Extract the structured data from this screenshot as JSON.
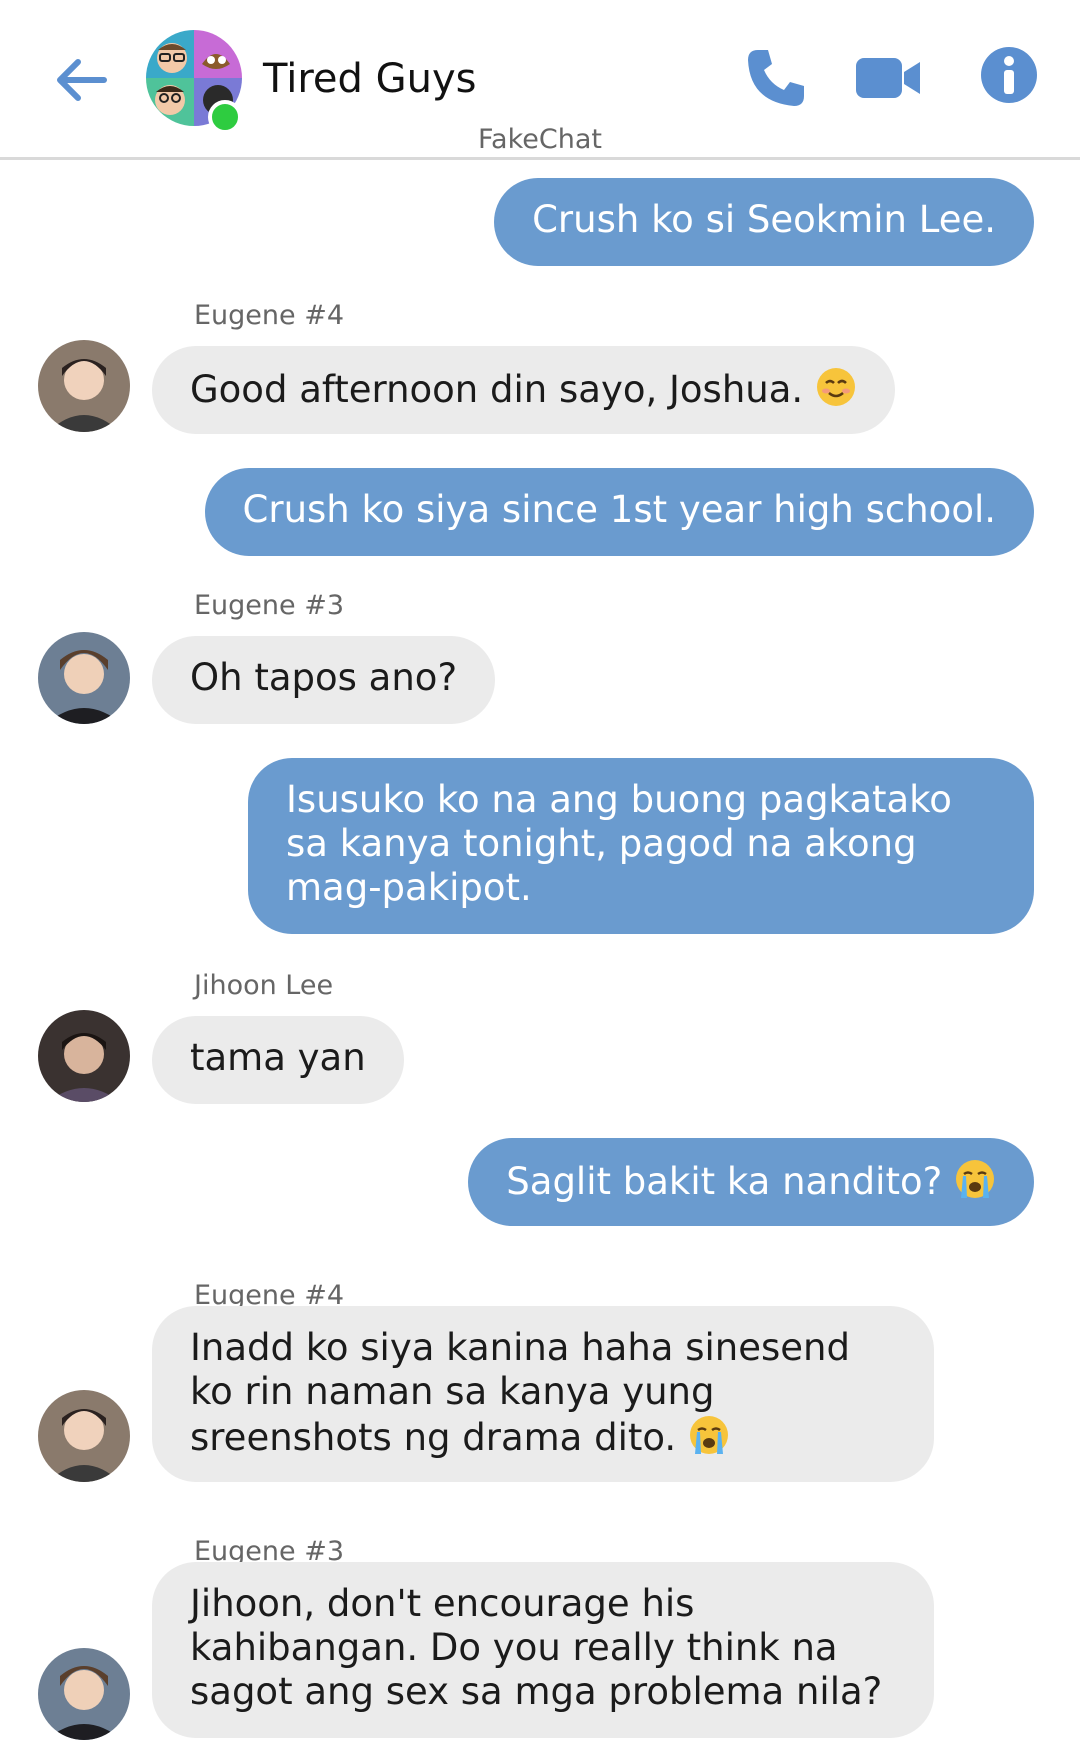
{
  "header": {
    "title": "Tired Guys",
    "watermark": "FakeChat",
    "back_icon": "arrow-left-icon",
    "call_icon": "phone-icon",
    "video_icon": "video-camera-icon",
    "info_icon": "info-icon",
    "accent_color": "#5b8fd0",
    "online_color": "#2ecc40"
  },
  "colors": {
    "outgoing_bubble": "#6a9bcf",
    "incoming_bubble": "#ebebeb"
  },
  "messages": [
    {
      "direction": "out",
      "text": "Crush ko si Seokmin Lee."
    },
    {
      "direction": "in",
      "sender": "Eugene #4",
      "text": "Good afternoon din sayo, Joshua.",
      "emoji": "smiling-blush-emoji"
    },
    {
      "direction": "out",
      "text": "Crush ko siya since 1st year high school."
    },
    {
      "direction": "in",
      "sender": "Eugene #3",
      "text": "Oh tapos ano?"
    },
    {
      "direction": "out",
      "text": "Isusuko ko na ang buong pagkatako sa kanya tonight, pagod na akong mag-pakipot."
    },
    {
      "direction": "in",
      "sender": "Jihoon Lee",
      "text": "tama yan"
    },
    {
      "direction": "out",
      "text": "Saglit bakit ka nandito?",
      "emoji": "crying-emoji"
    },
    {
      "direction": "in",
      "sender": "Eugene #4",
      "text": "Inadd ko siya kanina haha sinesend ko rin naman sa kanya yung sreenshots ng drama dito.",
      "emoji": "crying-emoji"
    },
    {
      "direction": "in",
      "sender": "Eugene #3",
      "text": "Jihoon, don't encourage his kahibangan. Do you really think na sagot ang sex sa mga problema nila?"
    }
  ]
}
